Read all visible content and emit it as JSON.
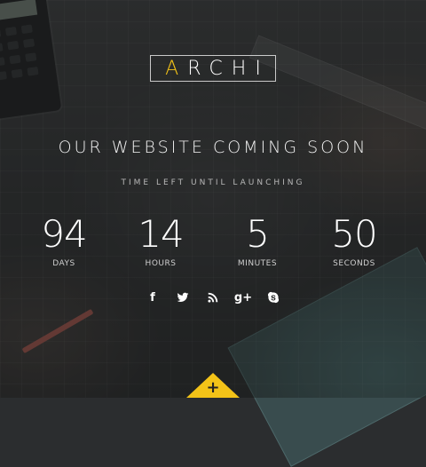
{
  "brand": {
    "logo_first_letter": "A",
    "logo_rest": "RCHI",
    "accent_color": "#f3c318"
  },
  "hero": {
    "headline": "OUR WEBSITE COMING SOON",
    "subline": "TIME LEFT UNTIL LAUNCHING"
  },
  "countdown": [
    {
      "value": "94",
      "label": "DAYS"
    },
    {
      "value": "14",
      "label": "HOURS"
    },
    {
      "value": "5",
      "label": "MINUTES"
    },
    {
      "value": "50",
      "label": "SECONDS"
    }
  ],
  "social": [
    {
      "name": "facebook-icon",
      "glyph": "f"
    },
    {
      "name": "twitter-icon",
      "glyph": ""
    },
    {
      "name": "rss-icon",
      "glyph": ""
    },
    {
      "name": "google-plus-icon",
      "glyph": "g+"
    },
    {
      "name": "skype-icon",
      "glyph": ""
    }
  ],
  "toggle": {
    "icon": "plus-icon",
    "glyph": "+"
  }
}
